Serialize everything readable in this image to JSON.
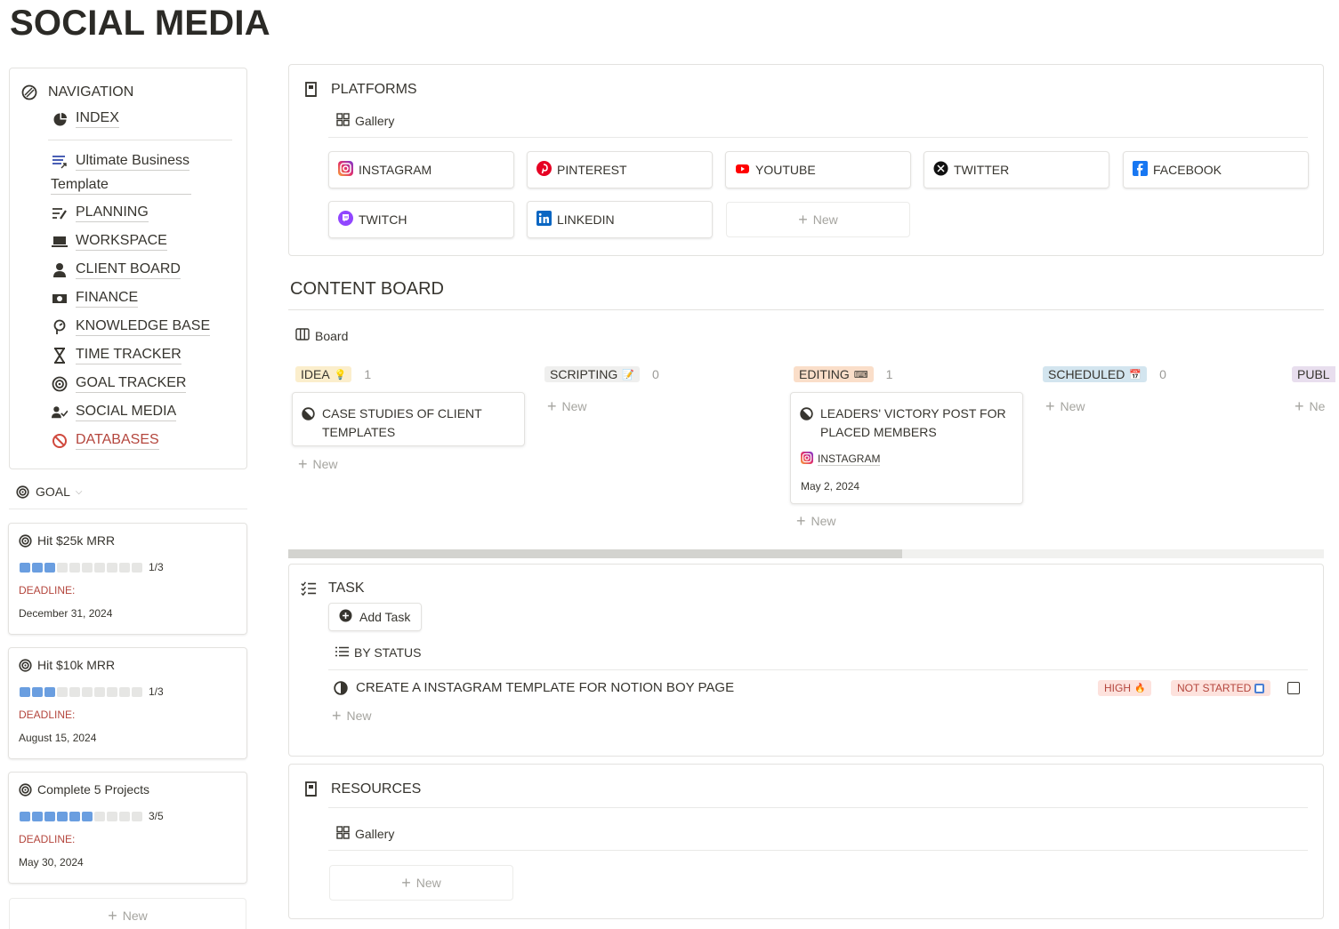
{
  "page": {
    "title": "SOCIAL MEDIA"
  },
  "navigation": {
    "heading": "NAVIGATION",
    "index": "INDEX",
    "ubt_line1": "Ultimate Business",
    "ubt_line2": "Template",
    "items": [
      "PLANNING",
      "WORKSPACE",
      "CLIENT BOARD",
      "FINANCE",
      "KNOWLEDGE BASE",
      "TIME TRACKER",
      "GOAL TRACKER",
      "SOCIAL MEDIA",
      "DATABASES"
    ]
  },
  "goal": {
    "heading": "GOAL",
    "cards": [
      {
        "title": "Hit $25k MRR",
        "done": 3,
        "total": 10,
        "count": "1/3",
        "deadline_label": "DEADLINE:",
        "deadline": "December 31, 2024"
      },
      {
        "title": "Hit $10k MRR",
        "done": 3,
        "total": 10,
        "count": "1/3",
        "deadline_label": "DEADLINE:",
        "deadline": "August 15, 2024"
      },
      {
        "title": "Complete 5 Projects",
        "done": 6,
        "total": 10,
        "count": "3/5",
        "deadline_label": "DEADLINE:",
        "deadline": "May 30, 2024"
      }
    ],
    "new_label": "New"
  },
  "platforms": {
    "heading": "PLATFORMS",
    "view": "Gallery",
    "items": [
      "INSTAGRAM",
      "PINTEREST",
      "YOUTUBE",
      "TWITTER",
      "FACEBOOK",
      "TWITCH",
      "LINKEDIN"
    ],
    "new_label": "New"
  },
  "content_board": {
    "heading": "CONTENT BOARD",
    "view": "Board",
    "columns": [
      {
        "name": "IDEA",
        "count": "1",
        "color": "#fbeecc",
        "emoji": "💡"
      },
      {
        "name": "SCRIPTING",
        "count": "0",
        "color": "#efefee",
        "emoji": "📝"
      },
      {
        "name": "EDITING",
        "count": "1",
        "color": "#fadec9",
        "emoji": "⌨"
      },
      {
        "name": "SCHEDULED",
        "count": "0",
        "color": "#d3e5ef",
        "emoji": "📅"
      },
      {
        "name": "PUBL",
        "count": "",
        "color": "#e8deee",
        "emoji": ""
      }
    ],
    "idea_card": "CASE STUDIES OF CLIENT TEMPLATES",
    "editing_card": {
      "title": "LEADERS' VICTORY POST FOR PLACED MEMBERS",
      "platform": "INSTAGRAM",
      "date": "May 2, 2024"
    },
    "new_label": "New",
    "new_short": "Ne"
  },
  "task": {
    "heading": "TASK",
    "add_label": "Add Task",
    "view": "BY STATUS",
    "rows": [
      {
        "title": "CREATE A INSTAGRAM TEMPLATE FOR NOTION BOY PAGE",
        "priority": "HIGH",
        "status": "NOT STARTED"
      }
    ],
    "new_label": "New"
  },
  "resources": {
    "heading": "RESOURCES",
    "view": "Gallery",
    "new_label": "New"
  },
  "colors": {
    "accent_red": "#b4463d",
    "progress": "#6a9ee0"
  }
}
